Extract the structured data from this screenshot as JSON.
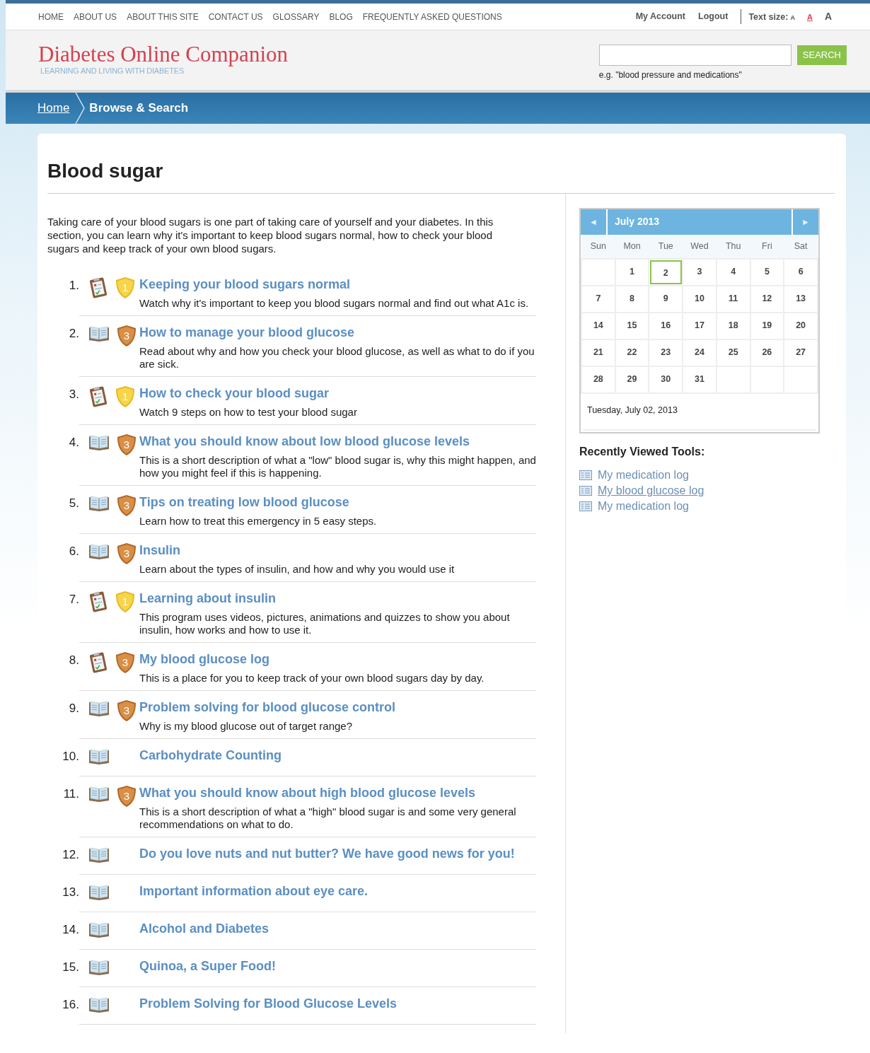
{
  "top_nav": {
    "links": [
      "HOME",
      "ABOUT US",
      "ABOUT THIS SITE",
      "CONTACT US",
      "GLOSSARY",
      "BLOG",
      "FREQUENTLY ASKED QUESTIONS"
    ],
    "account_links": [
      "My Account",
      "Logout"
    ],
    "text_size": {
      "label": "Text size:",
      "options": [
        {
          "label": "A",
          "selected": false
        },
        {
          "label": "A",
          "selected": true
        },
        {
          "label": "A",
          "selected": false
        }
      ]
    }
  },
  "header": {
    "logo": "Diabetes Online Companion",
    "tagline": "LEARNING AND LIVING WITH DIABETES",
    "search": {
      "button": "SEARCH",
      "hint": "e.g. \"blood pressure and medications\""
    }
  },
  "breadcrumb": [
    {
      "label": "Home",
      "link": true
    },
    {
      "label": "Browse & Search",
      "link": false
    }
  ],
  "page_title": "Blood sugar",
  "intro": "Taking care of your blood sugars is one part of taking care of yourself and your diabetes. In this section, you can learn why it's important to keep blood sugars normal, how to check your blood sugars and keep track of your own blood sugars.",
  "items": [
    {
      "number": "1.",
      "kind": "tool",
      "badge": {
        "level": "1",
        "kind": "gold"
      },
      "title": "Keeping your blood sugars normal",
      "description": "Watch why it's important to keep you blood sugars normal and find out what A1c is."
    },
    {
      "number": "2.",
      "kind": "article",
      "badge": {
        "level": "3",
        "kind": "bronze"
      },
      "title": "How to manage your blood glucose",
      "description": "Read about why and how you check your blood glucose, as well as what to do if you are sick."
    },
    {
      "number": "3.",
      "kind": "tool",
      "badge": {
        "level": "1",
        "kind": "gold"
      },
      "title": "How to check your blood sugar",
      "description": "Watch 9 steps on how to test your blood sugar"
    },
    {
      "number": "4.",
      "kind": "article",
      "badge": {
        "level": "3",
        "kind": "bronze"
      },
      "title": "What you should know about low blood glucose levels",
      "description": "This is a short description of what a \"low\" blood sugar is, why this might happen, and how you might feel if this is happening."
    },
    {
      "number": "5.",
      "kind": "article",
      "badge": {
        "level": "3",
        "kind": "bronze"
      },
      "title": "Tips on treating low blood glucose",
      "description": "Learn how to treat this emergency in 5 easy steps."
    },
    {
      "number": "6.",
      "kind": "article",
      "badge": {
        "level": "3",
        "kind": "bronze"
      },
      "title": "Insulin",
      "description": "Learn about the types of insulin, and how and why you would use it"
    },
    {
      "number": "7.",
      "kind": "tool",
      "badge": {
        "level": "1",
        "kind": "gold"
      },
      "title": "Learning about insulin",
      "description": "This program uses videos, pictures, animations and quizzes to show you about insulin, how works and how to use it."
    },
    {
      "number": "8.",
      "kind": "tool",
      "badge": {
        "level": "3",
        "kind": "bronze"
      },
      "title": "My blood glucose log",
      "description": "This is a place for you to keep track of your own blood sugars day by day."
    },
    {
      "number": "9.",
      "kind": "article",
      "badge": {
        "level": "3",
        "kind": "bronze"
      },
      "title": "Problem solving for blood glucose control",
      "description": "Why is my blood glucose out of target range?"
    },
    {
      "number": "10.",
      "kind": "article",
      "title": "Carbohydrate Counting"
    },
    {
      "number": "11.",
      "kind": "article",
      "badge": {
        "level": "3",
        "kind": "bronze"
      },
      "title": "What you should know about high blood glucose levels",
      "description": "This is a short description of what a \"high\" blood sugar is and some very general recommendations on what to do."
    },
    {
      "number": "12.",
      "kind": "article",
      "title": "Do you love nuts and nut butter? We have good news for you!"
    },
    {
      "number": "13.",
      "kind": "article",
      "title": "Important information about eye care."
    },
    {
      "number": "14.",
      "kind": "article",
      "title": "Alcohol and Diabetes"
    },
    {
      "number": "15.",
      "kind": "article",
      "title": "Quinoa, a Super Food!"
    },
    {
      "number": "16.",
      "kind": "article",
      "title": "Problem Solving for Blood Glucose Levels"
    }
  ],
  "calendar": {
    "prev": "◄",
    "month": "July 2013",
    "next": "►",
    "weekdays": [
      "Sun",
      "Mon",
      "Tue",
      "Wed",
      "Thu",
      "Fri",
      "Sat"
    ],
    "weeks": [
      [
        {
          "day": "1",
          "selected": false
        },
        {
          "day": "2",
          "selected": true
        },
        {
          "day": "3",
          "selected": false
        },
        {
          "day": "4",
          "selected": false
        },
        {
          "day": "5",
          "selected": false
        },
        {
          "day": "6",
          "selected": false
        }
      ],
      [
        {
          "day": "7",
          "selected": false
        },
        {
          "day": "8",
          "selected": false
        },
        {
          "day": "9",
          "selected": false
        },
        {
          "day": "10",
          "selected": false
        },
        {
          "day": "11",
          "selected": false
        },
        {
          "day": "12",
          "selected": false
        },
        {
          "day": "13",
          "selected": false
        }
      ],
      [
        {
          "day": "14",
          "selected": false
        },
        {
          "day": "15",
          "selected": false
        },
        {
          "day": "16",
          "selected": false
        },
        {
          "day": "17",
          "selected": false
        },
        {
          "day": "18",
          "selected": false
        },
        {
          "day": "19",
          "selected": false
        },
        {
          "day": "20",
          "selected": false
        }
      ],
      [
        {
          "day": "21",
          "selected": false
        },
        {
          "day": "22",
          "selected": false
        },
        {
          "day": "23",
          "selected": false
        },
        {
          "day": "24",
          "selected": false
        },
        {
          "day": "25",
          "selected": false
        },
        {
          "day": "26",
          "selected": false
        },
        {
          "day": "27",
          "selected": false
        }
      ],
      [
        {
          "day": "28",
          "selected": false
        },
        {
          "day": "29",
          "selected": false
        },
        {
          "day": "30",
          "selected": false
        },
        {
          "day": "31",
          "selected": false
        }
      ]
    ],
    "selected_date": "Tuesday, July 02, 2013"
  },
  "recent_tools": {
    "title": "Recently Viewed Tools:",
    "items": [
      {
        "label": "My medication log",
        "underlined": false
      },
      {
        "label": "My blood glucose log",
        "underlined": true
      },
      {
        "label": "My medication log",
        "underlined": false
      }
    ]
  }
}
